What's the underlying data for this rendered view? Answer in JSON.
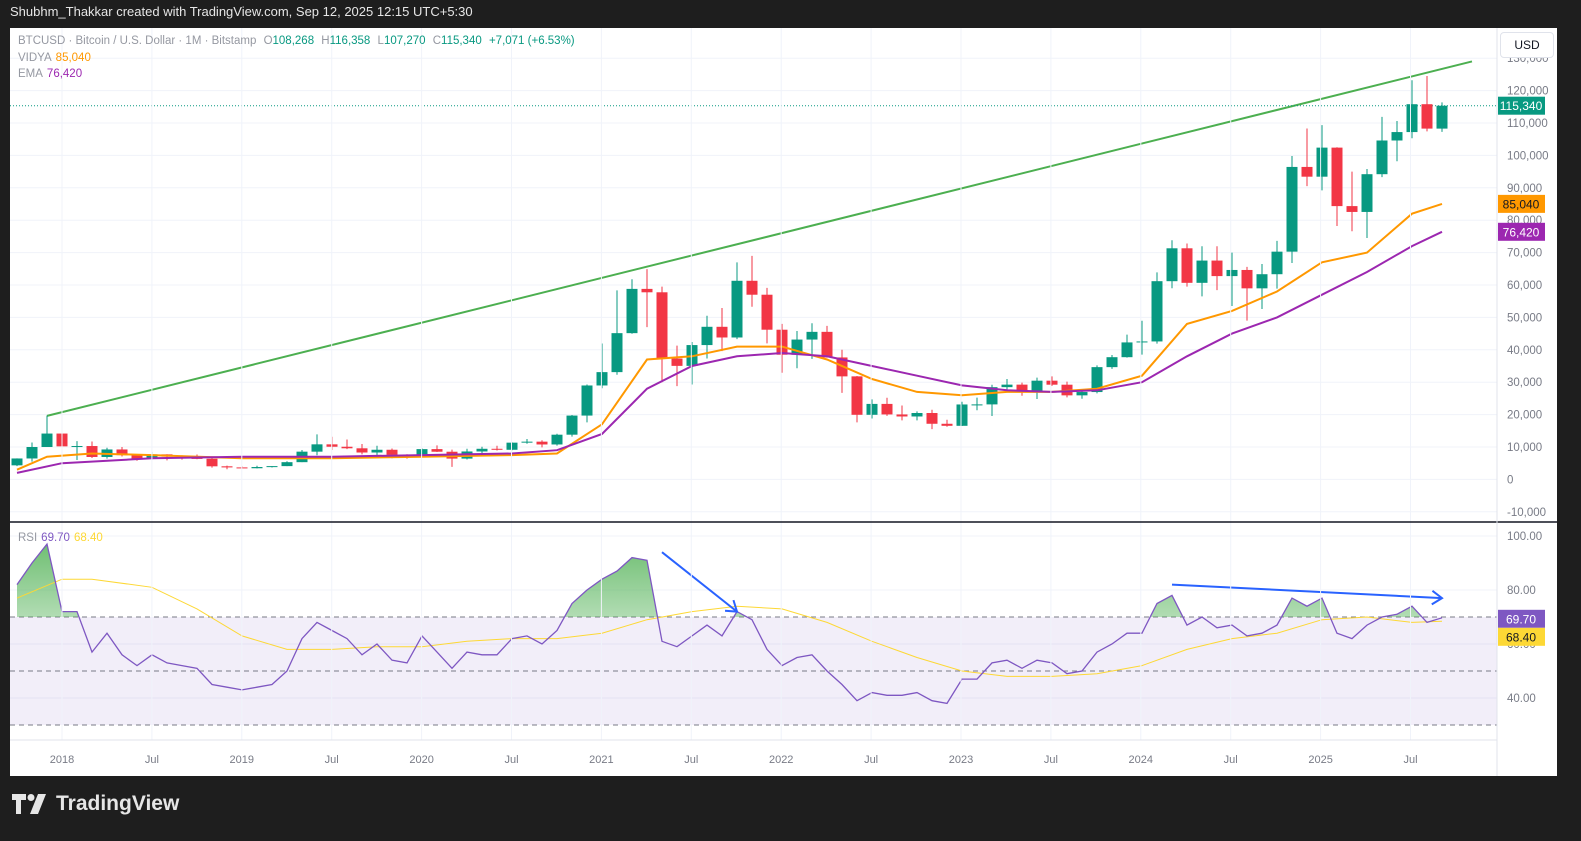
{
  "topbar": {
    "credit": "Shubhm_Thakkar created with TradingView.com, Sep 12, 2025 12:15 UTC+5:30"
  },
  "legend": {
    "symbol": "BTCUSD · Bitcoin / U.S. Dollar · 1M · Bitstamp",
    "o_label": "O",
    "o": "108,268",
    "h_label": "H",
    "h": "116,358",
    "l_label": "L",
    "l": "107,270",
    "c_label": "C",
    "c": "115,340",
    "change": "+7,071 (+6.53%)",
    "vidya_label": "VIDYA",
    "vidya": "85,040",
    "ema_label": "EMA",
    "ema": "76,420",
    "rsi_label": "RSI",
    "rsi": "69.70",
    "rsi_ma": "68.40"
  },
  "currency_button": "USD",
  "footer": {
    "brand": "TradingView"
  },
  "colors": {
    "up": "#089981",
    "down": "#f23645",
    "vidya": "#ff9800",
    "ema": "#9c27b0",
    "rsi": "#7e57c2",
    "rsi_ma": "#fdd835",
    "trendline": "#4caf50",
    "arrow": "#2962ff"
  },
  "chart_data": [
    {
      "type": "candlestick",
      "interval": "1M",
      "start": "2017-10",
      "ohlc": [
        [
          4340,
          6470,
          4110,
          6460
        ],
        [
          6460,
          11400,
          5500,
          10000
        ],
        [
          10000,
          19666,
          10900,
          14150
        ],
        [
          14150,
          17200,
          9000,
          10200
        ],
        [
          10200,
          11800,
          6000,
          10300
        ],
        [
          10300,
          11700,
          6600,
          6920
        ],
        [
          6920,
          9750,
          6430,
          9240
        ],
        [
          9240,
          9990,
          7060,
          7490
        ],
        [
          7490,
          7760,
          5750,
          6390
        ],
        [
          6390,
          8500,
          6070,
          7730
        ],
        [
          7730,
          7750,
          5880,
          7030
        ],
        [
          7030,
          7410,
          6110,
          6630
        ],
        [
          6630,
          7680,
          6200,
          6370
        ],
        [
          6370,
          6600,
          3650,
          4040
        ],
        [
          4040,
          4240,
          3120,
          3700
        ],
        [
          3700,
          4110,
          3380,
          3440
        ],
        [
          3440,
          4200,
          3400,
          3820
        ],
        [
          3820,
          4100,
          3680,
          4100
        ],
        [
          4100,
          5600,
          4080,
          5320
        ],
        [
          5320,
          9070,
          5340,
          8560
        ],
        [
          8560,
          13880,
          7450,
          10820
        ],
        [
          10820,
          13150,
          9060,
          10080
        ],
        [
          10080,
          12320,
          9350,
          9600
        ],
        [
          9600,
          10920,
          7710,
          8300
        ],
        [
          8300,
          10370,
          7300,
          9150
        ],
        [
          9150,
          9520,
          6520,
          7560
        ],
        [
          7560,
          7750,
          6430,
          7190
        ],
        [
          7190,
          9580,
          6870,
          9350
        ],
        [
          9350,
          10500,
          8450,
          8540
        ],
        [
          8540,
          9190,
          3850,
          6420
        ],
        [
          6420,
          9470,
          6150,
          8620
        ],
        [
          8620,
          10080,
          8120,
          9450
        ],
        [
          9450,
          10380,
          8910,
          9140
        ],
        [
          9140,
          11440,
          8980,
          11340
        ],
        [
          11340,
          12470,
          10990,
          11650
        ],
        [
          11650,
          12070,
          9880,
          10780
        ],
        [
          10780,
          14100,
          10430,
          13800
        ],
        [
          13800,
          19860,
          13210,
          19700
        ],
        [
          19700,
          29300,
          17600,
          28990
        ],
        [
          28990,
          41950,
          28130,
          33110
        ],
        [
          33110,
          58350,
          32300,
          45140
        ],
        [
          45140,
          61780,
          44950,
          58800
        ],
        [
          58800,
          64900,
          47000,
          57750
        ],
        [
          57750,
          59500,
          30000,
          37300
        ],
        [
          37300,
          41300,
          28800,
          35040
        ],
        [
          35040,
          42400,
          29300,
          41460
        ],
        [
          41460,
          50500,
          37330,
          47100
        ],
        [
          47100,
          52900,
          39600,
          43800
        ],
        [
          43800,
          67000,
          43300,
          61300
        ],
        [
          61300,
          69000,
          53300,
          57000
        ],
        [
          57000,
          59100,
          42000,
          46200
        ],
        [
          46200,
          48000,
          32900,
          38480
        ],
        [
          38480,
          45800,
          34300,
          43160
        ],
        [
          43160,
          48200,
          37200,
          45540
        ],
        [
          45540,
          47400,
          37600,
          37640
        ],
        [
          37640,
          40000,
          26700,
          31800
        ],
        [
          31800,
          31900,
          17600,
          19940
        ],
        [
          19940,
          24700,
          18800,
          23300
        ],
        [
          23300,
          25200,
          19600,
          20050
        ],
        [
          20050,
          22800,
          18200,
          19420
        ],
        [
          19420,
          21000,
          18200,
          20490
        ],
        [
          20490,
          21480,
          15500,
          17170
        ],
        [
          17170,
          18400,
          16260,
          16540
        ],
        [
          16540,
          23960,
          16500,
          23130
        ],
        [
          23130,
          25250,
          21350,
          23150
        ],
        [
          23150,
          29200,
          19550,
          28470
        ],
        [
          28470,
          31000,
          26940,
          29250
        ],
        [
          29250,
          29850,
          25800,
          27220
        ],
        [
          27220,
          31400,
          24800,
          30470
        ],
        [
          30470,
          31800,
          28860,
          29230
        ],
        [
          29230,
          30190,
          25300,
          25940
        ],
        [
          25940,
          27490,
          24900,
          26960
        ],
        [
          26960,
          35200,
          26550,
          34650
        ],
        [
          34650,
          38400,
          34100,
          37720
        ],
        [
          37720,
          44700,
          37600,
          42280
        ],
        [
          42280,
          48970,
          38500,
          42580
        ],
        [
          42580,
          63900,
          41900,
          61180
        ],
        [
          61180,
          73800,
          59000,
          71330
        ],
        [
          71330,
          72800,
          59500,
          60670
        ],
        [
          60670,
          71960,
          56500,
          67540
        ],
        [
          67540,
          71950,
          58400,
          62750
        ],
        [
          62750,
          70000,
          53500,
          64640
        ],
        [
          64640,
          65600,
          49000,
          58970
        ],
        [
          58970,
          66500,
          52600,
          63330
        ],
        [
          63330,
          73600,
          58900,
          70290
        ],
        [
          70290,
          99800,
          66800,
          96440
        ],
        [
          96440,
          108300,
          90500,
          93430
        ],
        [
          93430,
          109350,
          89200,
          102400
        ],
        [
          102400,
          102500,
          78200,
          84350
        ],
        [
          84350,
          95000,
          76600,
          82550
        ],
        [
          82550,
          95800,
          74500,
          94200
        ],
        [
          94200,
          111900,
          93300,
          104600
        ],
        [
          104600,
          110600,
          98200,
          107200
        ],
        [
          107200,
          123200,
          105300,
          115800
        ],
        [
          115800,
          124500,
          107400,
          108270
        ],
        [
          108268,
          116358,
          107270,
          115340
        ]
      ],
      "overlays": [
        {
          "name": "VIDYA",
          "points": [
            [
              "2017-10",
              3000
            ],
            [
              "2017-12",
              7000
            ],
            [
              "2018-03",
              8000
            ],
            [
              "2018-07",
              7500
            ],
            [
              "2019-01",
              6500
            ],
            [
              "2019-07",
              6500
            ],
            [
              "2020-01",
              7000
            ],
            [
              "2020-07",
              7500
            ],
            [
              "2020-10",
              8000
            ],
            [
              "2021-01",
              17000
            ],
            [
              "2021-04",
              37000
            ],
            [
              "2021-07",
              38000
            ],
            [
              "2021-10",
              41000
            ],
            [
              "2022-01",
              41000
            ],
            [
              "2022-04",
              37000
            ],
            [
              "2022-07",
              31000
            ],
            [
              "2022-10",
              27000
            ],
            [
              "2023-01",
              26000
            ],
            [
              "2023-04",
              27000
            ],
            [
              "2023-07",
              27000
            ],
            [
              "2023-10",
              28000
            ],
            [
              "2024-01",
              32000
            ],
            [
              "2024-04",
              48000
            ],
            [
              "2024-07",
              52000
            ],
            [
              "2024-10",
              58000
            ],
            [
              "2025-01",
              67000
            ],
            [
              "2025-04",
              70000
            ],
            [
              "2025-07",
              82000
            ],
            [
              "2025-09",
              85040
            ]
          ]
        },
        {
          "name": "EMA",
          "points": [
            [
              "2017-10",
              2000
            ],
            [
              "2018-01",
              5000
            ],
            [
              "2018-07",
              6500
            ],
            [
              "2019-01",
              7000
            ],
            [
              "2019-07",
              7000
            ],
            [
              "2020-01",
              7500
            ],
            [
              "2020-07",
              8000
            ],
            [
              "2020-10",
              9000
            ],
            [
              "2021-01",
              14000
            ],
            [
              "2021-04",
              28000
            ],
            [
              "2021-07",
              35000
            ],
            [
              "2021-10",
              38000
            ],
            [
              "2022-01",
              39000
            ],
            [
              "2022-04",
              38000
            ],
            [
              "2022-07",
              35000
            ],
            [
              "2022-10",
              32000
            ],
            [
              "2023-01",
              29000
            ],
            [
              "2023-04",
              27500
            ],
            [
              "2023-07",
              27000
            ],
            [
              "2023-10",
              27500
            ],
            [
              "2024-01",
              30000
            ],
            [
              "2024-04",
              38000
            ],
            [
              "2024-07",
              45000
            ],
            [
              "2024-10",
              50000
            ],
            [
              "2025-01",
              57000
            ],
            [
              "2025-04",
              64000
            ],
            [
              "2025-07",
              72000
            ],
            [
              "2025-09",
              76420
            ]
          ]
        }
      ],
      "trendline": [
        [
          "2017-12",
          19600
        ],
        [
          "2025-11",
          129000
        ]
      ],
      "last_price_label": "115,340",
      "y_ticks": [
        "-10,000",
        "0",
        "10,000",
        "20,000",
        "30,000",
        "40,000",
        "50,000",
        "60,000",
        "70,000",
        "80,000",
        "90,000",
        "100,000",
        "110,000",
        "120,000",
        "130,000"
      ],
      "ylim": [
        -13000,
        139000
      ]
    },
    {
      "type": "line",
      "title": "RSI",
      "start": "2017-10",
      "rsi": [
        82,
        90,
        97,
        72,
        72,
        57,
        64,
        56,
        52,
        56,
        53,
        52,
        51,
        45,
        44,
        43,
        44,
        45,
        50,
        62,
        68,
        65,
        62,
        56,
        60,
        54,
        53,
        63,
        57,
        51,
        57,
        56,
        56,
        62,
        63,
        60,
        65,
        75,
        80,
        84,
        87,
        92,
        91,
        61,
        59,
        63,
        67,
        63,
        72,
        69,
        58,
        52,
        55,
        56,
        50,
        45,
        39,
        42,
        41,
        41,
        42,
        39,
        38,
        47,
        47,
        53,
        54,
        51,
        54,
        53,
        49,
        50,
        57,
        60,
        64,
        64,
        75,
        78,
        67,
        70,
        66,
        67,
        63,
        64,
        67,
        77,
        74,
        77,
        64,
        62,
        67,
        70,
        71,
        74,
        68,
        69.7
      ],
      "rsi_ma": [
        [
          "2017-10",
          77
        ],
        [
          "2018-01",
          84
        ],
        [
          "2018-03",
          84
        ],
        [
          "2018-07",
          81
        ],
        [
          "2018-10",
          73
        ],
        [
          "2019-01",
          63
        ],
        [
          "2019-04",
          58
        ],
        [
          "2019-07",
          58
        ],
        [
          "2019-10",
          59
        ],
        [
          "2020-01",
          59
        ],
        [
          "2020-04",
          61
        ],
        [
          "2020-07",
          62
        ],
        [
          "2020-10",
          62
        ],
        [
          "2021-01",
          64
        ],
        [
          "2021-04",
          69
        ],
        [
          "2021-07",
          72
        ],
        [
          "2021-10",
          74
        ],
        [
          "2022-01",
          73
        ],
        [
          "2022-04",
          68
        ],
        [
          "2022-07",
          61
        ],
        [
          "2022-10",
          55
        ],
        [
          "2023-01",
          50
        ],
        [
          "2023-04",
          48
        ],
        [
          "2023-07",
          48
        ],
        [
          "2023-10",
          49
        ],
        [
          "2024-01",
          52
        ],
        [
          "2024-04",
          58
        ],
        [
          "2024-07",
          62
        ],
        [
          "2024-10",
          64
        ],
        [
          "2025-01",
          69
        ],
        [
          "2025-04",
          70
        ],
        [
          "2025-07",
          68
        ],
        [
          "2025-09",
          68.4
        ]
      ],
      "bands": [
        70,
        50,
        30
      ],
      "arrows": [
        [
          [
            "2021-05",
            94
          ],
          [
            "2021-10",
            72
          ]
        ],
        [
          [
            "2024-03",
            82
          ],
          [
            "2025-09",
            77
          ]
        ]
      ],
      "y_ticks": [
        "40.00",
        "60.00",
        "80.00",
        "100.00"
      ],
      "ylim": [
        23,
        100
      ],
      "last_labels": [
        "69.70",
        "68.40"
      ]
    }
  ],
  "x_ticks": [
    "2018",
    "Jul",
    "2019",
    "Jul",
    "2020",
    "Jul",
    "2021",
    "Jul",
    "2022",
    "Jul",
    "2023",
    "Jul",
    "2024",
    "Jul",
    "2025",
    "Jul"
  ]
}
